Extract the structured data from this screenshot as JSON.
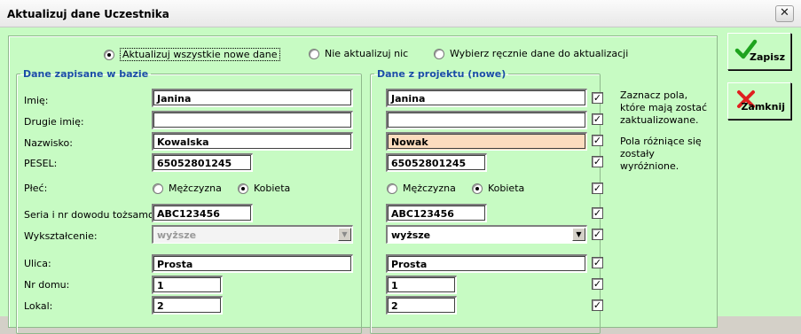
{
  "window": {
    "title": "Aktualizuj dane Uczestnika",
    "close_glyph": "✕"
  },
  "mode": {
    "options": [
      {
        "label": "Aktualizuj wszystkie nowe dane",
        "selected": true
      },
      {
        "label": "Nie aktualizuj nic",
        "selected": false
      },
      {
        "label": "Wybierz ręcznie dane do aktualizacji",
        "selected": false
      }
    ]
  },
  "db": {
    "legend": "Dane zapisane w bazie",
    "labels": {
      "first_name": "Imię:",
      "second_name": "Drugie imię:",
      "surname": "Nazwisko:",
      "pesel": "PESEL:",
      "gender": "Płeć:",
      "id_card": "Seria i nr dowodu tożsamości:",
      "education": "Wykształcenie:",
      "street": "Ulica:",
      "house_no": "Nr domu:",
      "flat_no": "Lokal:"
    },
    "values": {
      "first_name": "Janina",
      "second_name": "",
      "surname": "Kowalska",
      "pesel": "65052801245",
      "id_card": "ABC123456",
      "education": "wyższe",
      "street": "Prosta",
      "house_no": "1",
      "flat_no": "2"
    },
    "gender_options": [
      "Mężczyzna",
      "Kobieta"
    ],
    "gender_selected": "Kobieta"
  },
  "project": {
    "legend": "Dane z projektu (nowe)",
    "values": {
      "first_name": "Janina",
      "second_name": "",
      "surname": "Nowak",
      "pesel": "65052801245",
      "id_card": "ABC123456",
      "education": "wyższe",
      "street": "Prosta",
      "house_no": "1",
      "flat_no": "2"
    },
    "gender_options": [
      "Mężczyzna",
      "Kobieta"
    ],
    "gender_selected": "Kobieta",
    "checked": [
      "first_name",
      "second_name",
      "surname",
      "pesel",
      "gender",
      "id_card",
      "education",
      "street",
      "house_no",
      "flat_no"
    ],
    "check_glyph": "✓",
    "diff_color": "#fcdcbe"
  },
  "notes": {
    "select_fields": "Zaznacz pola, które mają zostać zaktualizowane.",
    "differences": "Pola różniące się zostały wyróżnione."
  },
  "buttons": {
    "save": {
      "label": "Zapisz",
      "icon": "checkmark-icon",
      "color": "#1ea31e"
    },
    "close": {
      "label": "Zamknij",
      "icon": "cross-icon",
      "color": "#e02020"
    }
  },
  "colors": {
    "background": "#c7fbc3",
    "legend": "#1a4ea6"
  }
}
